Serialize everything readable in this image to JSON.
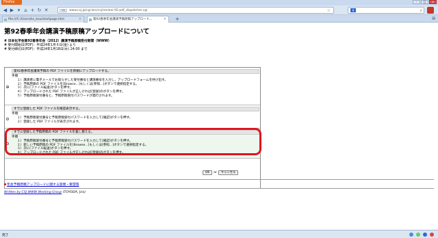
{
  "browser": {
    "app_button": "Firefox",
    "url": "www.csj.jp/cgi-bin/csj/nenkai-92-pdf_dispatcher.cgi",
    "search_engine_icon": "google-icon",
    "tabs": [
      {
        "label": "file:///C:/Users/ks_kou/startpage.htm"
      },
      {
        "label": "第92春季年会講演予稿原稿アップロード..."
      }
    ],
    "status": "完了",
    "colors": {
      "app_button": "#e66a1a",
      "highlight": "#e0141c",
      "link": "#0000cc"
    }
  },
  "page": {
    "title": "第92春季年会講演予稿原稿アップロードについて",
    "meta": {
      "heading": "# 日本化学会第92春季年会（2012）講演予稿原稿受付期間（WWW）",
      "start": "# 受付開始日(PDF)：平成24年1月６日(金) より",
      "end": "# 受付締切日(PDF)：平成24年1月18日(水) 24:00 まで"
    },
    "sections": [
      {
        "label": "第92春季年会講演予稿の PDF ファイルを新規にアップロードする。",
        "selected": true,
        "head": "手順",
        "steps": [
          "１）講演者に電子メールでお知らせした受付番号と講演番号を入力し、アップロードフォームを呼び出す。",
          "２）予稿原稿の PDF ファイルを[Browse...]もしくは[参照...]ボタンで選択指定する。",
          "３）次に[ファイル転送]ボタンを押す。",
          "４）アップロードされた PDF ファイルが正しければ[登録]のボタンを押す。",
          "５）予稿原稿受付番号と、予稿原稿受付パスワードが発行されます。"
        ]
      },
      {
        "label": "すでに登録した PDF ファイルを確認表示する。",
        "selected": false,
        "head": "手順",
        "steps": [
          "１）予稿原稿受付番号と予稿原稿受付パスワードを入力して[確認]ボタンを押す。",
          "２）登録した PDF ファイルが表示されます。"
        ]
      },
      {
        "label": "すでに登録した予稿原稿の PDF ファイルを差し替える。",
        "selected": false,
        "head": "手順",
        "steps": [
          "１）予稿原稿受付番号と予稿原稿受付パスワードを入力して[確認]ボタンを押す。",
          "２）新しい予稿原稿の PDF ファイルを[Browse...]もしくは[参照...]ボタンで選択指定する。",
          "３）次に[ファイル転送]ボタンを押す。",
          "４）アップロードされた PDF ファイルが正しければ[登録]のボタンを押す。"
        ]
      }
    ],
    "ok_label": "OK",
    "or_text": "or",
    "cancel_label": "キャンセル",
    "inquiry_link": "年会予稿原稿アップロードに関する質問・要望等",
    "credit_link": "Written by CSJ WWW Working Group",
    "credit_author": "(TOYODA, Jiro)"
  }
}
